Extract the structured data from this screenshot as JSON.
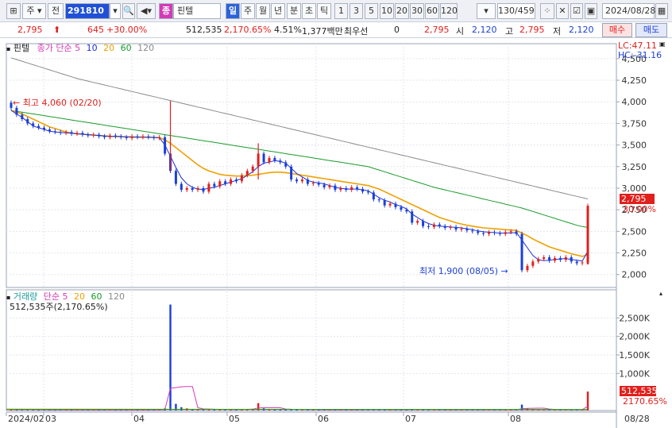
{
  "toolbar": {
    "type_label": "주",
    "market_label": "전",
    "code": "291810",
    "badge": "종",
    "name": "핀텔",
    "periods": [
      "일",
      "주",
      "월",
      "년",
      "분",
      "초",
      "틱"
    ],
    "intervals": [
      "1",
      "3",
      "5",
      "10",
      "20",
      "30",
      "60",
      "120"
    ],
    "count": "130/459",
    "date": "2024/08/28"
  },
  "quote": {
    "price": "2,795",
    "change": "645",
    "change_pct": "+30.00%",
    "volume": "512,535",
    "volume_pct": "2,170.65%",
    "turnover": "4.51%",
    "amount": "1,377백만",
    "priority_label": "최우선",
    "priority_value": "0",
    "priority_price": "2,795",
    "open_label": "시",
    "open": "2,120",
    "high_label": "고",
    "high": "2,795",
    "low_label": "저",
    "low": "2,120",
    "buy_label": "매수",
    "sell_label": "매도"
  },
  "price_panel": {
    "title": "핀텔",
    "legend_prefix": "종가 단순",
    "ma": [
      "5",
      "10",
      "20",
      "60",
      "120"
    ],
    "colors": {
      "ma5": "#7a1fc0",
      "ma10": "#1f2fd6",
      "ma20": "#f0a000",
      "ma60": "#1a9b2a",
      "ma120": "#8a8a8a",
      "up": "#e0201c",
      "down": "#1b3fd8"
    },
    "lc": "LC:47.11",
    "hc": "HC:-31.16",
    "high_note": "최고 4,060 (02/20)",
    "low_note": "최저 1,900 (08/05)",
    "last_price": "2,795",
    "last_pct": "30.00%"
  },
  "volume_panel": {
    "legend_name": "거래량",
    "legend_prefix": "단순",
    "ma": [
      "5",
      "20",
      "60",
      "120"
    ],
    "value_line": "512,535주(2,170.65%)",
    "last_value": "512,535",
    "last_pct": "2170.65%"
  },
  "chart_data": [
    {
      "type": "candlestick",
      "title": "",
      "y_ticks": [
        2000,
        2250,
        2500,
        2750,
        3000,
        3250,
        3500,
        3750,
        4000,
        4250,
        4500
      ],
      "y_tick_labels": [
        "2,000",
        "2,250",
        "2,500",
        "2,750",
        "3,000",
        "3,250",
        "3,500",
        "3,750",
        "4,000",
        "4,250",
        "4,500"
      ],
      "ylim": [
        1850,
        4600
      ],
      "x_labels": [
        "2024/02",
        "03",
        "04",
        "05",
        "06",
        "07",
        "08",
        "08/28"
      ],
      "closes": [
        3930,
        3850,
        3800,
        3750,
        3720,
        3700,
        3680,
        3660,
        3650,
        3640,
        3650,
        3630,
        3640,
        3620,
        3610,
        3620,
        3600,
        3590,
        3610,
        3600,
        3590,
        3580,
        3600,
        3590,
        3600,
        3590,
        3580,
        3590,
        3400,
        3200,
        3050,
        2980,
        3000,
        2980,
        3000,
        2960,
        3050,
        3020,
        3080,
        3050,
        3100,
        3080,
        3150,
        3200,
        3250,
        3400,
        3300,
        3350,
        3320,
        3300,
        3250,
        3100,
        3080,
        3100,
        3050,
        3060,
        3040,
        3010,
        3030,
        2980,
        3000,
        2980,
        3010,
        2990,
        2960,
        2950,
        2870,
        2860,
        2800,
        2820,
        2780,
        2750,
        2730,
        2600,
        2620,
        2560,
        2550,
        2580,
        2560,
        2540,
        2550,
        2520,
        2530,
        2510,
        2500,
        2480,
        2470,
        2490,
        2480,
        2470,
        2490,
        2500,
        2470,
        2050,
        2100,
        2150,
        2180,
        2200,
        2160,
        2190,
        2170,
        2200,
        2150,
        2130,
        2140,
        2795
      ],
      "ma5": [
        3900,
        3860,
        3820,
        3770,
        3720,
        3700,
        3680,
        3660,
        3650,
        3645,
        3640,
        3635,
        3630,
        3625,
        3620,
        3615,
        3610,
        3605,
        3600,
        3600,
        3598,
        3595,
        3593,
        3592,
        3590,
        3590,
        3588,
        3585,
        3500,
        3370,
        3240,
        3120,
        3050,
        3010,
        2990,
        2985,
        3000,
        3010,
        3030,
        3050,
        3070,
        3090,
        3110,
        3150,
        3190,
        3250,
        3290,
        3300,
        3320,
        3310,
        3290,
        3230,
        3170,
        3130,
        3090,
        3070,
        3060,
        3050,
        3030,
        3010,
        3000,
        2990,
        2990,
        2990,
        2980,
        2970,
        2930,
        2890,
        2860,
        2840,
        2810,
        2790,
        2760,
        2700,
        2660,
        2620,
        2590,
        2570,
        2560,
        2555,
        2550,
        2545,
        2540,
        2530,
        2520,
        2505,
        2495,
        2490,
        2485,
        2480,
        2480,
        2482,
        2485,
        2400,
        2310,
        2220,
        2170,
        2160,
        2165,
        2175,
        2180,
        2185,
        2175,
        2165,
        2155,
        2270
      ],
      "ma20": [
        3900,
        3880,
        3860,
        3830,
        3800,
        3770,
        3740,
        3710,
        3690,
        3670,
        3650,
        3640,
        3630,
        3625,
        3620,
        3615,
        3610,
        3605,
        3600,
        3598,
        3596,
        3594,
        3592,
        3590,
        3590,
        3588,
        3586,
        3584,
        3560,
        3520,
        3470,
        3420,
        3370,
        3320,
        3270,
        3230,
        3200,
        3180,
        3160,
        3150,
        3145,
        3140,
        3140,
        3145,
        3150,
        3160,
        3170,
        3180,
        3185,
        3185,
        3180,
        3170,
        3160,
        3150,
        3140,
        3130,
        3120,
        3110,
        3100,
        3090,
        3080,
        3070,
        3060,
        3050,
        3040,
        3030,
        3010,
        2990,
        2960,
        2930,
        2900,
        2870,
        2840,
        2810,
        2780,
        2750,
        2720,
        2690,
        2660,
        2640,
        2620,
        2600,
        2585,
        2570,
        2560,
        2550,
        2540,
        2535,
        2530,
        2525,
        2520,
        2515,
        2510,
        2480,
        2450,
        2410,
        2380,
        2350,
        2320,
        2300,
        2280,
        2260,
        2240,
        2225,
        2210,
        2230
      ],
      "ma60": [
        3900,
        3890,
        3880,
        3870,
        3860,
        3850,
        3840,
        3830,
        3820,
        3810,
        3800,
        3790,
        3780,
        3770,
        3760,
        3750,
        3740,
        3730,
        3720,
        3710,
        3700,
        3690,
        3680,
        3670,
        3660,
        3650,
        3640,
        3630,
        3620,
        3610,
        3600,
        3590,
        3580,
        3570,
        3560,
        3550,
        3540,
        3530,
        3520,
        3510,
        3500,
        3490,
        3480,
        3470,
        3460,
        3450,
        3440,
        3430,
        3420,
        3410,
        3400,
        3390,
        3380,
        3370,
        3360,
        3350,
        3340,
        3330,
        3320,
        3310,
        3300,
        3290,
        3280,
        3270,
        3260,
        3250,
        3230,
        3210,
        3190,
        3170,
        3150,
        3130,
        3110,
        3090,
        3070,
        3050,
        3030,
        3010,
        2995,
        2980,
        2965,
        2950,
        2935,
        2920,
        2905,
        2890,
        2875,
        2860,
        2845,
        2830,
        2815,
        2800,
        2785,
        2770,
        2750,
        2730,
        2710,
        2690,
        2670,
        2650,
        2630,
        2610,
        2590,
        2570,
        2555,
        2545
      ],
      "ma120": [
        4510,
        4490,
        4470,
        4450,
        4430,
        4410,
        4390,
        4370,
        4350,
        4330,
        4310,
        4290,
        4270,
        4255,
        4240,
        4225,
        4210,
        4195,
        4180,
        4165,
        4150,
        4135,
        4120,
        4105,
        4090,
        4075,
        4060,
        4045,
        4030,
        4015,
        4000,
        3985,
        3970,
        3955,
        3940,
        3925,
        3910,
        3895,
        3880,
        3865,
        3850,
        3835,
        3820,
        3805,
        3790,
        3775,
        3760,
        3745,
        3730,
        3715,
        3700,
        3685,
        3670,
        3655,
        3640,
        3625,
        3610,
        3595,
        3580,
        3565,
        3550,
        3535,
        3520,
        3505,
        3490,
        3475,
        3460,
        3445,
        3430,
        3415,
        3400,
        3385,
        3370,
        3355,
        3340,
        3325,
        3310,
        3295,
        3280,
        3265,
        3250,
        3235,
        3220,
        3205,
        3190,
        3175,
        3160,
        3145,
        3130,
        3115,
        3100,
        3085,
        3070,
        3055,
        3040,
        3025,
        3010,
        2995,
        2980,
        2965,
        2950,
        2935,
        2920,
        2905,
        2890,
        2875
      ]
    },
    {
      "type": "bar",
      "title": "",
      "y_ticks": [
        1000,
        1500,
        2000,
        2500
      ],
      "y_tick_labels": [
        "1,000K",
        "1,500K",
        "2,000K",
        "2,500K"
      ],
      "ylim": [
        0,
        3000
      ],
      "volumes": [
        30,
        20,
        25,
        30,
        20,
        18,
        22,
        20,
        18,
        25,
        20,
        18,
        20,
        22,
        18,
        20,
        18,
        20,
        22,
        18,
        20,
        18,
        20,
        18,
        20,
        18,
        20,
        22,
        60,
        2860,
        180,
        90,
        60,
        40,
        30,
        30,
        25,
        30,
        25,
        30,
        25,
        30,
        35,
        40,
        45,
        200,
        60,
        40,
        35,
        30,
        30,
        40,
        30,
        25,
        25,
        20,
        20,
        25,
        20,
        20,
        25,
        20,
        20,
        25,
        30,
        25,
        30,
        25,
        20,
        20,
        25,
        20,
        20,
        40,
        30,
        25,
        20,
        20,
        25,
        20,
        20,
        20,
        25,
        20,
        20,
        20,
        20,
        25,
        20,
        20,
        20,
        20,
        25,
        160,
        60,
        40,
        30,
        30,
        25,
        25,
        25,
        25,
        20,
        20,
        25,
        512
      ],
      "ma5_volume": [
        30,
        28,
        27,
        27,
        25,
        24,
        23,
        22,
        21,
        21,
        21,
        20,
        20,
        20,
        20,
        20,
        20,
        20,
        20,
        20,
        20,
        20,
        20,
        20,
        20,
        20,
        20,
        20,
        28,
        600,
        620,
        640,
        650,
        650,
        75,
        45,
        40,
        35,
        30,
        30,
        28,
        28,
        30,
        33,
        36,
        70,
        75,
        75,
        75,
        75,
        40,
        35,
        33,
        30,
        28,
        26,
        24,
        22,
        22,
        22,
        22,
        22,
        22,
        22,
        24,
        25,
        26,
        27,
        26,
        24,
        24,
        23,
        22,
        25,
        27,
        27,
        27,
        26,
        24,
        22,
        21,
        21,
        21,
        21,
        21,
        21,
        21,
        21,
        21,
        21,
        21,
        21,
        21,
        50,
        60,
        62,
        64,
        64,
        40,
        30,
        28,
        26,
        24,
        23,
        23,
        120
      ]
    }
  ]
}
